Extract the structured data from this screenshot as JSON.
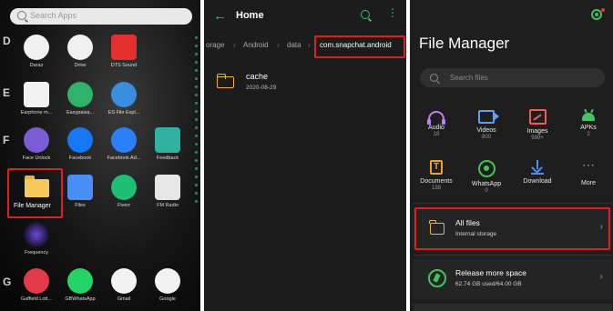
{
  "colors": {
    "accent_green": "#3ec25a",
    "highlight_red": "#e02020",
    "folder_yellow": "#f0b23c"
  },
  "panel1": {
    "search_placeholder": "Search Apps",
    "section_letters": [
      "D",
      "E",
      "F",
      "G"
    ],
    "apps": [
      {
        "label": "Daraz",
        "icon": "daraz-icon",
        "color": "#f0f0f0"
      },
      {
        "label": "Drive",
        "icon": "drive-icon",
        "color": "#f0f0f0"
      },
      {
        "label": "DTS Sound",
        "icon": "dts-icon",
        "color": "#e53030"
      },
      {
        "label": "Earphone m...",
        "icon": "earphone-icon",
        "color": "#e84040"
      },
      {
        "label": "Easypaisa...",
        "icon": "easypaisa-icon",
        "color": "#2fb26a"
      },
      {
        "label": "ES File Expl...",
        "icon": "es-file-icon",
        "color": "#3a8ee0"
      },
      {
        "label": "Face Unlock",
        "icon": "face-unlock-icon",
        "color": "#7b5bd6"
      },
      {
        "label": "Facebook",
        "icon": "facebook-icon",
        "color": "#1877f2"
      },
      {
        "label": "Facebook Ad...",
        "icon": "messenger-icon",
        "color": "#2d7ff9"
      },
      {
        "label": "Feedback",
        "icon": "feedback-icon",
        "color": "#2fb2a0"
      },
      {
        "label": "File Manager",
        "icon": "file-manager-icon",
        "color": "#f6c95a"
      },
      {
        "label": "Files",
        "icon": "files-icon",
        "color": "#4a8ff5"
      },
      {
        "label": "Fiverr",
        "icon": "fiverr-icon",
        "color": "#1dbf73"
      },
      {
        "label": "FM Radio",
        "icon": "fm-radio-icon",
        "color": "#e6e6e6"
      },
      {
        "label": "Frequency",
        "icon": "frequency-icon",
        "color": "#6a4bd8"
      },
      {
        "label": "Gaffield Lott...",
        "icon": "gaffield-icon",
        "color": "#e23a4a"
      },
      {
        "label": "GBWhatsApp",
        "icon": "gbwhatsapp-icon",
        "color": "#25d366"
      },
      {
        "label": "Gmail",
        "icon": "gmail-icon",
        "color": "#f2f2f2"
      },
      {
        "label": "Google",
        "icon": "google-icon",
        "color": "#f2f2f2"
      }
    ]
  },
  "panel2": {
    "title": "Home",
    "breadcrumb": [
      "orage",
      "Android",
      "data",
      "com.snapchat.android"
    ],
    "folder": {
      "name": "cache",
      "date": "2020-08-29"
    }
  },
  "panel3": {
    "title": "File Manager",
    "search_placeholder": "Search files",
    "categories": [
      {
        "name": "Audio",
        "count": "18",
        "icon": "audio-icon"
      },
      {
        "name": "Videos",
        "count": "800",
        "icon": "video-icon"
      },
      {
        "name": "Images",
        "count": "999+",
        "icon": "images-icon"
      },
      {
        "name": "APKs",
        "count": "2",
        "icon": "apk-icon"
      },
      {
        "name": "Documents",
        "count": "138",
        "icon": "document-icon"
      },
      {
        "name": "WhatsApp",
        "count": "0",
        "icon": "whatsapp-icon"
      },
      {
        "name": "Download",
        "count": "",
        "icon": "download-icon"
      },
      {
        "name": "More",
        "count": "",
        "icon": "more-icon"
      }
    ],
    "all_files": {
      "title": "All files",
      "subtitle": "Internal storage"
    },
    "release": {
      "title": "Release more space",
      "subtitle": "62.74 GB used/64.00 GB"
    }
  }
}
